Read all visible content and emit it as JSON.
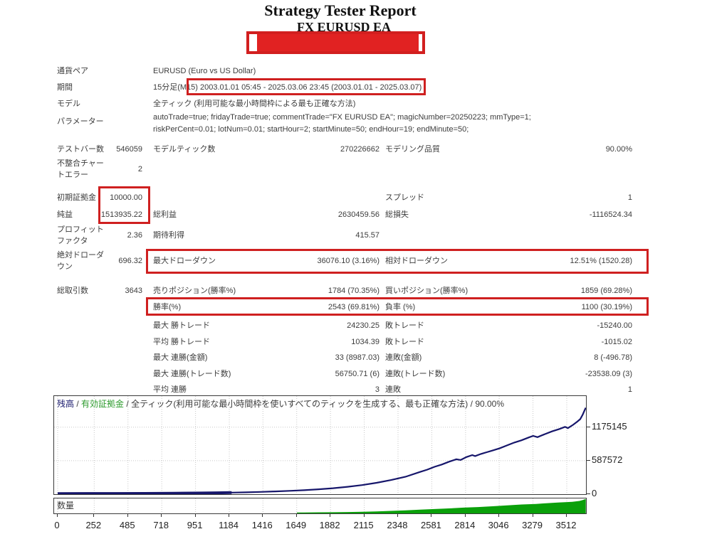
{
  "title": "Strategy Tester Report",
  "subtitle": "FX EURUSD EA",
  "colors": {
    "highlight_red": "#cf2020",
    "redaction_fill": "#e12222",
    "redaction_border": "#d21f1f",
    "text": "#3c3c3c",
    "balance_navy": "#16166b",
    "equity_green": "#2e9b2e",
    "volume_green": "#0aa00a",
    "grid_gray": "#c8c8c8"
  },
  "table": {
    "rows": [
      {
        "l1": "通貨ペア",
        "l2": "EURUSD (Euro vs US Dollar)"
      },
      {
        "l1": "期間",
        "l2": "15分足(M15) 2003.01.01 05:45 - 2025.03.06 23:45 (2003.01.01 - 2025.03.07)"
      },
      {
        "l1": "モデル",
        "l2": "全ティック (利用可能な最小時間枠による最も正確な方法)"
      },
      {
        "l1": "パラメーター",
        "l2": "autoTrade=true; fridayTrade=true; commentTrade=\"FX EURUSD EA\"; magicNumber=20250223; mmType=1; riskPerCent=0.01; lotNum=0.01; startHour=2; startMinute=50; endHour=19; endMinute=50;"
      },
      {
        "l1": "テストバー数",
        "v1": "546059",
        "l2": "モデルティック数",
        "v2": "270226662",
        "l3": "モデリング品質",
        "v3": "90.00%"
      },
      {
        "l1": "不整合チャートエラー",
        "v1": "2"
      },
      {
        "l1": "初期証拠金",
        "v1": "10000.00",
        "l3": "スプレッド",
        "v3": "1"
      },
      {
        "l1": "純益",
        "v1": "1513935.22",
        "l2": "総利益",
        "v2": "2630459.56",
        "l3": "総損失",
        "v3": "-1116524.34"
      },
      {
        "l1": "プロフィットファクタ",
        "v1": "2.36",
        "l2": "期待利得",
        "v2": "415.57"
      },
      {
        "l1": "絶対ドローダウン",
        "v1": "696.32",
        "l2": "最大ドローダウン",
        "v2": "36076.10 (3.16%)",
        "l3": "相対ドローダウン",
        "v3": "12.51% (1520.28)"
      },
      {
        "l1": "総取引数",
        "v1": "3643",
        "l2": "売りポジション(勝率%)",
        "v2": "1784 (70.35%)",
        "l3": "買いポジション(勝率%)",
        "v3": "1859 (69.28%)"
      },
      {
        "l2": "勝率(%)",
        "v2": "2543 (69.81%)",
        "l3": "負率 (%)",
        "v3": "1100 (30.19%)"
      },
      {
        "l2": "最大 勝トレード",
        "v2": "24230.25",
        "l3": "敗トレード",
        "v3": "-15240.00"
      },
      {
        "l2": "平均 勝トレード",
        "v2": "1034.39",
        "l3": "敗トレード",
        "v3": "-1015.02"
      },
      {
        "l2": "最大 連勝(金額)",
        "v2": "33 (8987.03)",
        "l3": "連敗(金額)",
        "v3": "8 (-496.78)"
      },
      {
        "l2": "最大 連勝(トレード数)",
        "v2": "56750.71 (6)",
        "l3": "連敗(トレード数)",
        "v3": "-23538.09 (3)"
      },
      {
        "l2": "平均 連勝",
        "v2": "3",
        "l3": "連敗",
        "v3": "1"
      }
    ]
  },
  "chart_data": {
    "type": "line",
    "legend": {
      "balance_label": "残高",
      "separator": " / ",
      "equity_label": "有効証拠金",
      "model_label": "全ティック(利用可能な最小時間枠を使いすべてのティックを生成する、最も正確な方法)",
      "quality": "90.00%"
    },
    "xlabel": "",
    "ylabel": "",
    "x_ticks": [
      0,
      252,
      485,
      718,
      951,
      1184,
      1416,
      1649,
      1882,
      2115,
      2348,
      2581,
      2814,
      3046,
      3279,
      3512
    ],
    "y_ticks": [
      0,
      587572,
      1175145
    ],
    "xlim": [
      0,
      3643
    ],
    "ylim": [
      0,
      1720000
    ],
    "grid": true,
    "legend_position": "top-left",
    "series": [
      {
        "name": "残高",
        "color": "#16166b",
        "points": [
          [
            0,
            10000
          ],
          [
            200,
            10600
          ],
          [
            400,
            11500
          ],
          [
            600,
            13000
          ],
          [
            800,
            16000
          ],
          [
            1000,
            20000
          ],
          [
            1100,
            24000
          ],
          [
            1200,
            28000
          ],
          [
            1300,
            33000
          ],
          [
            1400,
            40000
          ],
          [
            1500,
            48000
          ],
          [
            1600,
            58000
          ],
          [
            1700,
            70000
          ],
          [
            1800,
            86000
          ],
          [
            1900,
            105000
          ],
          [
            2000,
            130000
          ],
          [
            2100,
            160000
          ],
          [
            2200,
            200000
          ],
          [
            2300,
            248000
          ],
          [
            2400,
            305000
          ],
          [
            2500,
            390000
          ],
          [
            2550,
            430000
          ],
          [
            2600,
            480000
          ],
          [
            2650,
            520000
          ],
          [
            2700,
            570000
          ],
          [
            2750,
            612000
          ],
          [
            2780,
            600000
          ],
          [
            2820,
            650000
          ],
          [
            2860,
            685000
          ],
          [
            2880,
            668000
          ],
          [
            2920,
            705000
          ],
          [
            2960,
            735000
          ],
          [
            3000,
            765000
          ],
          [
            3050,
            805000
          ],
          [
            3100,
            855000
          ],
          [
            3150,
            905000
          ],
          [
            3200,
            945000
          ],
          [
            3250,
            995000
          ],
          [
            3280,
            1022000
          ],
          [
            3310,
            1000000
          ],
          [
            3360,
            1052000
          ],
          [
            3410,
            1100000
          ],
          [
            3460,
            1142000
          ],
          [
            3500,
            1180000
          ],
          [
            3520,
            1158000
          ],
          [
            3555,
            1215000
          ],
          [
            3585,
            1272000
          ],
          [
            3605,
            1315000
          ],
          [
            3622,
            1395000
          ],
          [
            3636,
            1475000
          ],
          [
            3643,
            1513935
          ]
        ]
      }
    ],
    "volume_series": {
      "name": "数量",
      "color": "#0aa00a",
      "max_lots": 15.8,
      "points": [
        [
          1650,
          0.9
        ],
        [
          1700,
          1.0
        ],
        [
          1800,
          1.1
        ],
        [
          1900,
          1.2
        ],
        [
          2000,
          1.4
        ],
        [
          2100,
          1.7
        ],
        [
          2200,
          2.1
        ],
        [
          2300,
          2.6
        ],
        [
          2400,
          3.2
        ],
        [
          2500,
          3.9
        ],
        [
          2600,
          4.6
        ],
        [
          2700,
          5.3
        ],
        [
          2800,
          6.1
        ],
        [
          2900,
          6.7
        ],
        [
          3000,
          7.5
        ],
        [
          3100,
          8.5
        ],
        [
          3200,
          9.4
        ],
        [
          3300,
          10.0
        ],
        [
          3350,
          10.5
        ],
        [
          3400,
          11.0
        ],
        [
          3450,
          11.4
        ],
        [
          3500,
          11.8
        ],
        [
          3550,
          12.2
        ],
        [
          3580,
          12.8
        ],
        [
          3600,
          13.2
        ],
        [
          3620,
          14.0
        ],
        [
          3635,
          14.8
        ],
        [
          3643,
          15.2
        ]
      ]
    }
  }
}
